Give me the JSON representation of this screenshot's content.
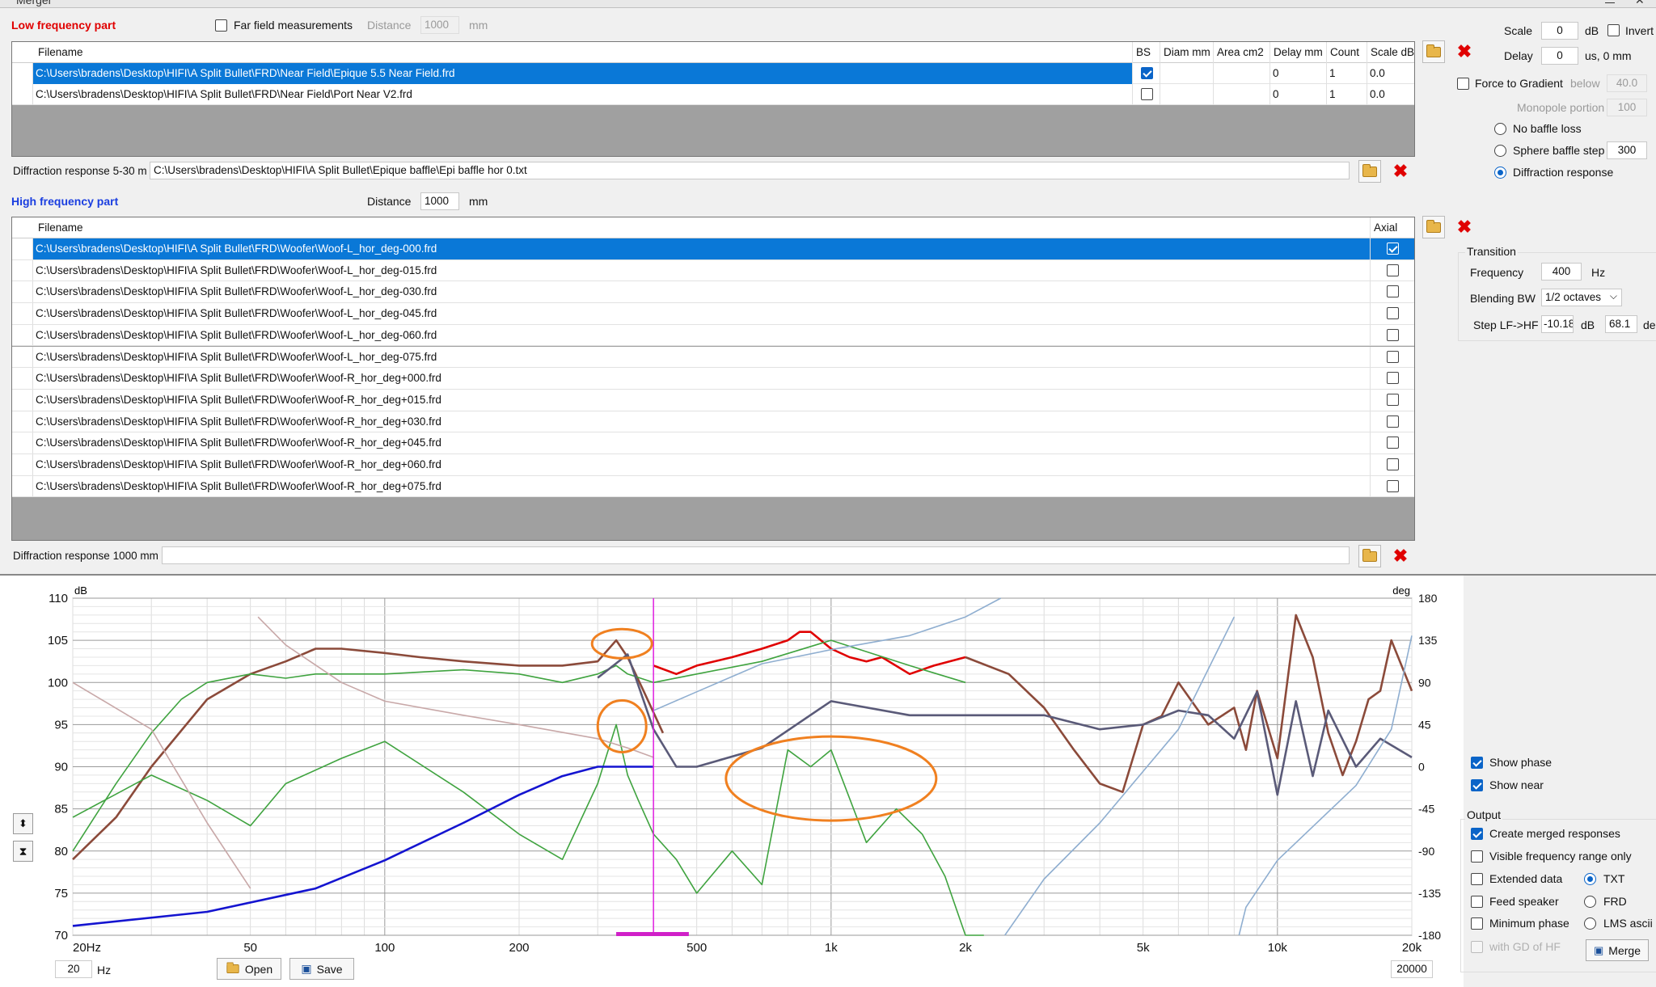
{
  "window": {
    "title": "Merger"
  },
  "low": {
    "title": "Low frequency part",
    "far_field_label": "Far field measurements",
    "distance_label": "Distance",
    "distance_value": "1000",
    "distance_unit": "mm",
    "columns": [
      "Filename",
      "BS",
      "Diam mm",
      "Area cm2",
      "Delay mm",
      "Count",
      "Scale dB"
    ],
    "rows": [
      {
        "filename": "C:\\Users\\bradens\\Desktop\\HIFI\\A Split Bullet\\FRD\\Near Field\\Epique 5.5 Near Field.frd",
        "bs": true,
        "diam": "",
        "area": "",
        "delay": "0",
        "count": "1",
        "scale": "0.0"
      },
      {
        "filename": "C:\\Users\\bradens\\Desktop\\HIFI\\A Split Bullet\\FRD\\Near Field\\Port Near V2.frd",
        "bs": false,
        "diam": "",
        "area": "",
        "delay": "0",
        "count": "1",
        "scale": "0.0"
      }
    ],
    "diffraction_label": "Diffraction response 5-30 m",
    "diffraction_value": "C:\\Users\\bradens\\Desktop\\HIFI\\A Split Bullet\\Epique baffle\\Epi baffle hor 0.txt"
  },
  "right_top": {
    "scale_label": "Scale",
    "scale_value": "0",
    "scale_unit": "dB",
    "invert_label": "Invert",
    "delay_label": "Delay",
    "delay_value": "0",
    "delay_unit": "us, 0 mm",
    "force_gradient_label": "Force to Gradient",
    "below_label": "below",
    "below_value": "40.0",
    "monopole_label": "Monopole portion",
    "monopole_value": "100",
    "no_baffle_label": "No baffle loss",
    "sphere_label": "Sphere baffle step",
    "sphere_value": "300",
    "diffraction_label": "Diffraction response"
  },
  "high": {
    "title": "High frequency part",
    "distance_label": "Distance",
    "distance_value": "1000",
    "distance_unit": "mm",
    "columns": [
      "Filename",
      "Axial"
    ],
    "rows": [
      {
        "filename": "C:\\Users\\bradens\\Desktop\\HIFI\\A Split Bullet\\FRD\\Woofer\\Woof-L_hor_deg-000.frd",
        "axial": true
      },
      {
        "filename": "C:\\Users\\bradens\\Desktop\\HIFI\\A Split Bullet\\FRD\\Woofer\\Woof-L_hor_deg-015.frd",
        "axial": false
      },
      {
        "filename": "C:\\Users\\bradens\\Desktop\\HIFI\\A Split Bullet\\FRD\\Woofer\\Woof-L_hor_deg-030.frd",
        "axial": false
      },
      {
        "filename": "C:\\Users\\bradens\\Desktop\\HIFI\\A Split Bullet\\FRD\\Woofer\\Woof-L_hor_deg-045.frd",
        "axial": false
      },
      {
        "filename": "C:\\Users\\bradens\\Desktop\\HIFI\\A Split Bullet\\FRD\\Woofer\\Woof-L_hor_deg-060.frd",
        "axial": false
      },
      {
        "filename": "C:\\Users\\bradens\\Desktop\\HIFI\\A Split Bullet\\FRD\\Woofer\\Woof-L_hor_deg-075.frd",
        "axial": false
      },
      {
        "filename": "C:\\Users\\bradens\\Desktop\\HIFI\\A Split Bullet\\FRD\\Woofer\\Woof-R_hor_deg+000.frd",
        "axial": false
      },
      {
        "filename": "C:\\Users\\bradens\\Desktop\\HIFI\\A Split Bullet\\FRD\\Woofer\\Woof-R_hor_deg+015.frd",
        "axial": false
      },
      {
        "filename": "C:\\Users\\bradens\\Desktop\\HIFI\\A Split Bullet\\FRD\\Woofer\\Woof-R_hor_deg+030.frd",
        "axial": false
      },
      {
        "filename": "C:\\Users\\bradens\\Desktop\\HIFI\\A Split Bullet\\FRD\\Woofer\\Woof-R_hor_deg+045.frd",
        "axial": false
      },
      {
        "filename": "C:\\Users\\bradens\\Desktop\\HIFI\\A Split Bullet\\FRD\\Woofer\\Woof-R_hor_deg+060.frd",
        "axial": false
      },
      {
        "filename": "C:\\Users\\bradens\\Desktop\\HIFI\\A Split Bullet\\FRD\\Woofer\\Woof-R_hor_deg+075.frd",
        "axial": false
      }
    ],
    "diffraction_label": "Diffraction response 1000 mm",
    "diffraction_value": ""
  },
  "transition": {
    "title": "Transition",
    "frequency_label": "Frequency",
    "frequency_value": "400",
    "frequency_unit": "Hz",
    "blending_label": "Blending BW",
    "blending_value": "1/2 octaves",
    "step_label": "Step LF->HF",
    "step_db": "-10.18",
    "step_db_unit": "dB",
    "step_deg": "68.1",
    "step_deg_unit": "de"
  },
  "chart_data": {
    "type": "line",
    "xscale": "log",
    "xlim": [
      20,
      20000
    ],
    "ylim": [
      70,
      110
    ],
    "y2lim": [
      -180,
      180
    ],
    "ylabel": "dB",
    "y2label": "deg",
    "xticks": [
      "20Hz",
      "50",
      "100",
      "200",
      "500",
      "1k",
      "2k",
      "5k",
      "10k",
      "20k"
    ],
    "xtick_values": [
      20,
      50,
      100,
      200,
      500,
      1000,
      2000,
      5000,
      10000,
      20000
    ],
    "yticks": [
      110,
      105,
      100,
      95,
      90,
      85,
      80,
      75,
      70
    ],
    "y2ticks": [
      180,
      135,
      90,
      45,
      0,
      -45,
      -90,
      -135,
      -180
    ],
    "transition_hz": 400,
    "series": [
      {
        "color": "#8b4a3a",
        "axis": "left",
        "x": [
          20,
          25,
          30,
          40,
          50,
          60,
          70,
          80,
          100,
          120,
          150,
          200,
          250,
          300,
          330,
          350,
          380,
          420
        ],
        "y": [
          79,
          84,
          90,
          98,
          101,
          102.5,
          104,
          104,
          103.5,
          103,
          102.5,
          102,
          102,
          102.5,
          105,
          103,
          99,
          94
        ]
      },
      {
        "color": "#e00000",
        "axis": "left",
        "x": [
          400,
          450,
          500,
          600,
          700,
          800,
          850,
          900,
          1000,
          1100,
          1200,
          1300,
          1500,
          1700,
          2000
        ],
        "y": [
          102,
          101,
          102,
          103,
          104,
          105,
          106,
          106,
          104,
          103,
          102.5,
          103,
          101,
          102,
          103
        ]
      },
      {
        "color": "#8b4a3a",
        "axis": "left",
        "x": [
          2000,
          2500,
          3000,
          3500,
          4000,
          4500,
          5000,
          5500,
          6000,
          7000,
          8000,
          8500,
          9000,
          10000,
          11000,
          12000,
          13000,
          14000,
          15000,
          16000,
          17000,
          18000,
          20000
        ],
        "y": [
          103,
          101,
          97,
          92,
          88,
          87,
          95,
          96,
          100,
          95,
          97,
          92,
          99,
          91,
          108,
          103,
          94,
          89,
          93,
          98,
          99,
          105,
          99
        ]
      },
      {
        "color": "#3fa33f",
        "axis": "left",
        "x": [
          20,
          25,
          30,
          35,
          40,
          50,
          60,
          70,
          80,
          100,
          150,
          200,
          250,
          300,
          330,
          350,
          400,
          500,
          700,
          1000,
          1500,
          2000
        ],
        "y": [
          80,
          88,
          94,
          98,
          100,
          101,
          100.5,
          101,
          101,
          101,
          101.5,
          101,
          100,
          101,
          102,
          101,
          100,
          101,
          102.5,
          105,
          102,
          100
        ]
      },
      {
        "color": "#3fa33f",
        "axis": "left",
        "x": [
          20,
          30,
          40,
          50,
          60,
          80,
          100,
          150,
          200,
          250,
          300,
          330,
          350,
          370,
          400,
          450,
          500,
          600,
          700,
          800,
          900,
          1000,
          1200,
          1400,
          1600,
          1800,
          2000,
          2200
        ],
        "y": [
          84,
          89,
          86,
          83,
          88,
          91,
          93,
          87,
          82,
          79,
          88,
          95,
          89,
          86,
          82,
          79,
          75,
          80,
          76,
          92,
          90,
          92,
          81,
          85,
          82,
          77,
          70,
          70
        ]
      },
      {
        "color": "#1414d0",
        "axis": "right",
        "x": [
          20,
          40,
          70,
          100,
          150,
          200,
          250,
          300,
          350,
          400
        ],
        "y": [
          -170,
          -155,
          -130,
          -100,
          -60,
          -30,
          -10,
          0,
          0,
          0
        ]
      },
      {
        "color": "#5a5a78",
        "axis": "right",
        "x": [
          300,
          350,
          400,
          450,
          500,
          700,
          1000,
          1500,
          2000,
          3000,
          4000,
          5000,
          6000,
          7000,
          8000,
          9000,
          10000,
          11000,
          12000,
          13000,
          15000,
          17000,
          20000
        ],
        "y": [
          95,
          120,
          40,
          0,
          0,
          20,
          70,
          55,
          55,
          55,
          40,
          45,
          60,
          55,
          30,
          80,
          -30,
          70,
          -10,
          60,
          0,
          30,
          10
        ]
      },
      {
        "color": "#c8a8a8",
        "axis": "right",
        "x": [
          20,
          30,
          40,
          50,
          52,
          60,
          80,
          100,
          150,
          200,
          300,
          350,
          400
        ],
        "y": [
          90,
          40,
          -60,
          -130,
          160,
          130,
          90,
          70,
          55,
          45,
          30,
          20,
          10
        ]
      },
      {
        "color": "#8faed0",
        "axis": "right",
        "x": [
          400,
          500,
          700,
          1000,
          1500,
          2000,
          2400,
          2450,
          3000,
          4000,
          6000,
          8000,
          8200,
          8500,
          10000,
          15000,
          18000,
          20000
        ],
        "y": [
          60,
          80,
          110,
          125,
          140,
          160,
          180,
          -180,
          -120,
          -60,
          40,
          160,
          -180,
          -150,
          -100,
          -20,
          40,
          140
        ]
      }
    ],
    "annotations": [
      "ellipse-330hz-peak",
      "ellipse-330hz-dip",
      "ellipse-700hz-1.5khz"
    ]
  },
  "chart_controls": {
    "min_freq": "20",
    "min_unit": "Hz",
    "max_freq": "20000",
    "open_label": "Open",
    "save_label": "Save"
  },
  "options": {
    "show_phase": "Show phase",
    "show_near": "Show near",
    "output_title": "Output",
    "create_merged": "Create merged responses",
    "visible_range": "Visible frequency range only",
    "extended": "Extended data",
    "txt": "TXT",
    "feed": "Feed speaker",
    "frd": "FRD",
    "min_phase": "Minimum phase",
    "lms": "LMS ascii",
    "gd_hf": "with GD of HF",
    "merge_label": "Merge"
  }
}
